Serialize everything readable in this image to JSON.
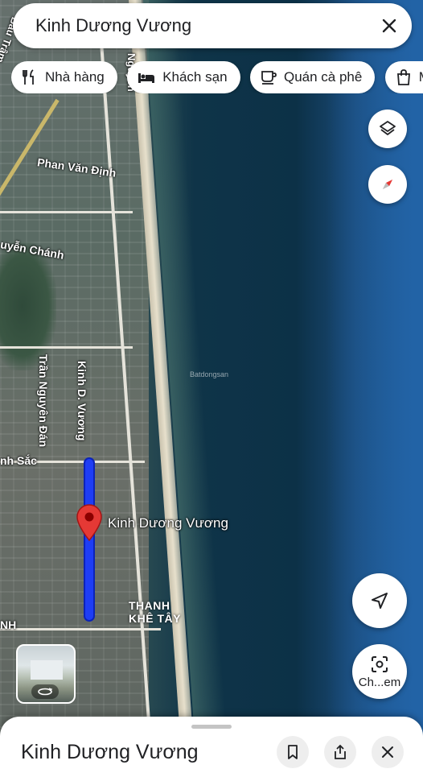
{
  "search": {
    "query": "Kinh Dương Vương"
  },
  "chips": [
    {
      "label": "Nhà hàng",
      "icon": "restaurant-icon"
    },
    {
      "label": "Khách sạn",
      "icon": "hotel-icon"
    },
    {
      "label": "Quán cà phê",
      "icon": "coffee-icon"
    },
    {
      "label": "M",
      "icon": "shopping-bag-icon"
    }
  ],
  "map": {
    "street_labels": {
      "bau_tram": "Bàu Trâm",
      "nguyen": "Nguyễn",
      "phan_van_dinh": "Phan Văn Định",
      "nguyen_chanh": "uyễn Chánh",
      "tran_nguyen_dan": "Trần Nguyên Đán",
      "kinh_d_vuong": "Kinh D. Vương",
      "anh_sac": "nh Sắc",
      "nh": "NH"
    },
    "pin_label": "Kinh Dương Vương",
    "district_line1": "THANH",
    "district_line2": "KHÊ TÂY",
    "watermark": "Batdongsan"
  },
  "buttons": {
    "scan_label": "Ch...em"
  },
  "sheet": {
    "title": "Kinh Dương Vương"
  },
  "colors": {
    "route": "#1e3df5",
    "pin": "#e53935"
  }
}
